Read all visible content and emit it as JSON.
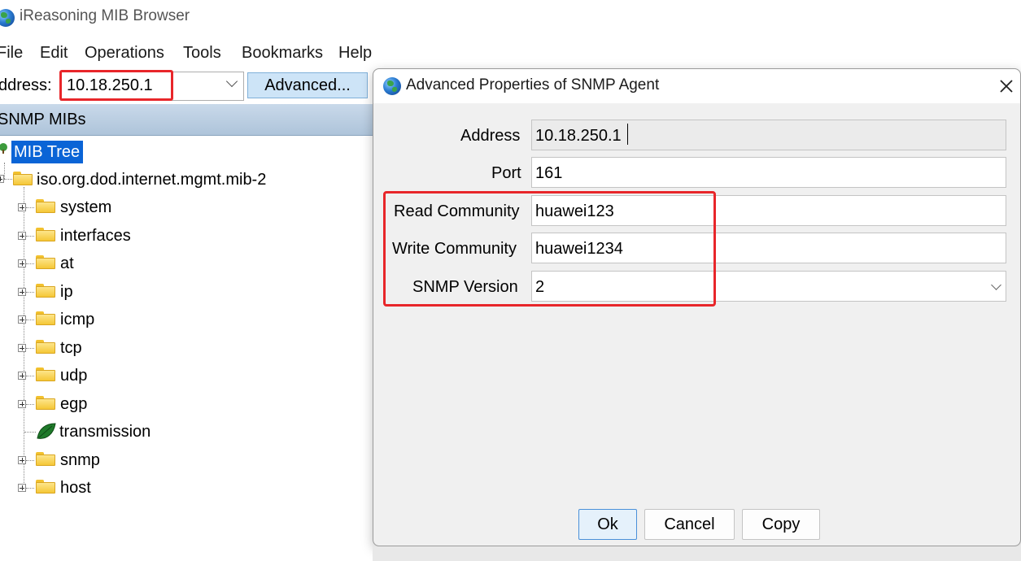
{
  "app": {
    "title": "iReasoning MIB Browser"
  },
  "menu": [
    "File",
    "Edit",
    "Operations",
    "Tools",
    "Bookmarks",
    "Help"
  ],
  "toolbar": {
    "address_label": "ddress:",
    "address_value": "10.18.250.1",
    "advanced_label": "Advanced..."
  },
  "mib_panel": {
    "header": "SNMP MIBs",
    "root": "MIB Tree",
    "branch": "iso.org.dod.internet.mgmt.mib-2",
    "children": [
      "system",
      "interfaces",
      "at",
      "ip",
      "icmp",
      "tcp",
      "udp",
      "egp",
      "transmission",
      "snmp",
      "host"
    ]
  },
  "dialog": {
    "title": "Advanced Properties of SNMP Agent",
    "close_icon": "close-icon",
    "fields": {
      "address": {
        "label": "Address",
        "value": "10.18.250.1"
      },
      "port": {
        "label": "Port",
        "value": "161"
      },
      "read_community": {
        "label": "Read Community",
        "value": "huawei123"
      },
      "write_community": {
        "label": "Write Community",
        "value": "huawei1234"
      },
      "snmp_version": {
        "label": "SNMP Version",
        "value": "2"
      }
    },
    "buttons": {
      "ok": "Ok",
      "cancel": "Cancel",
      "copy": "Copy"
    }
  },
  "colors": {
    "highlight": "#e8262a",
    "selection": "#0a64d6",
    "header": "#aec4da"
  }
}
